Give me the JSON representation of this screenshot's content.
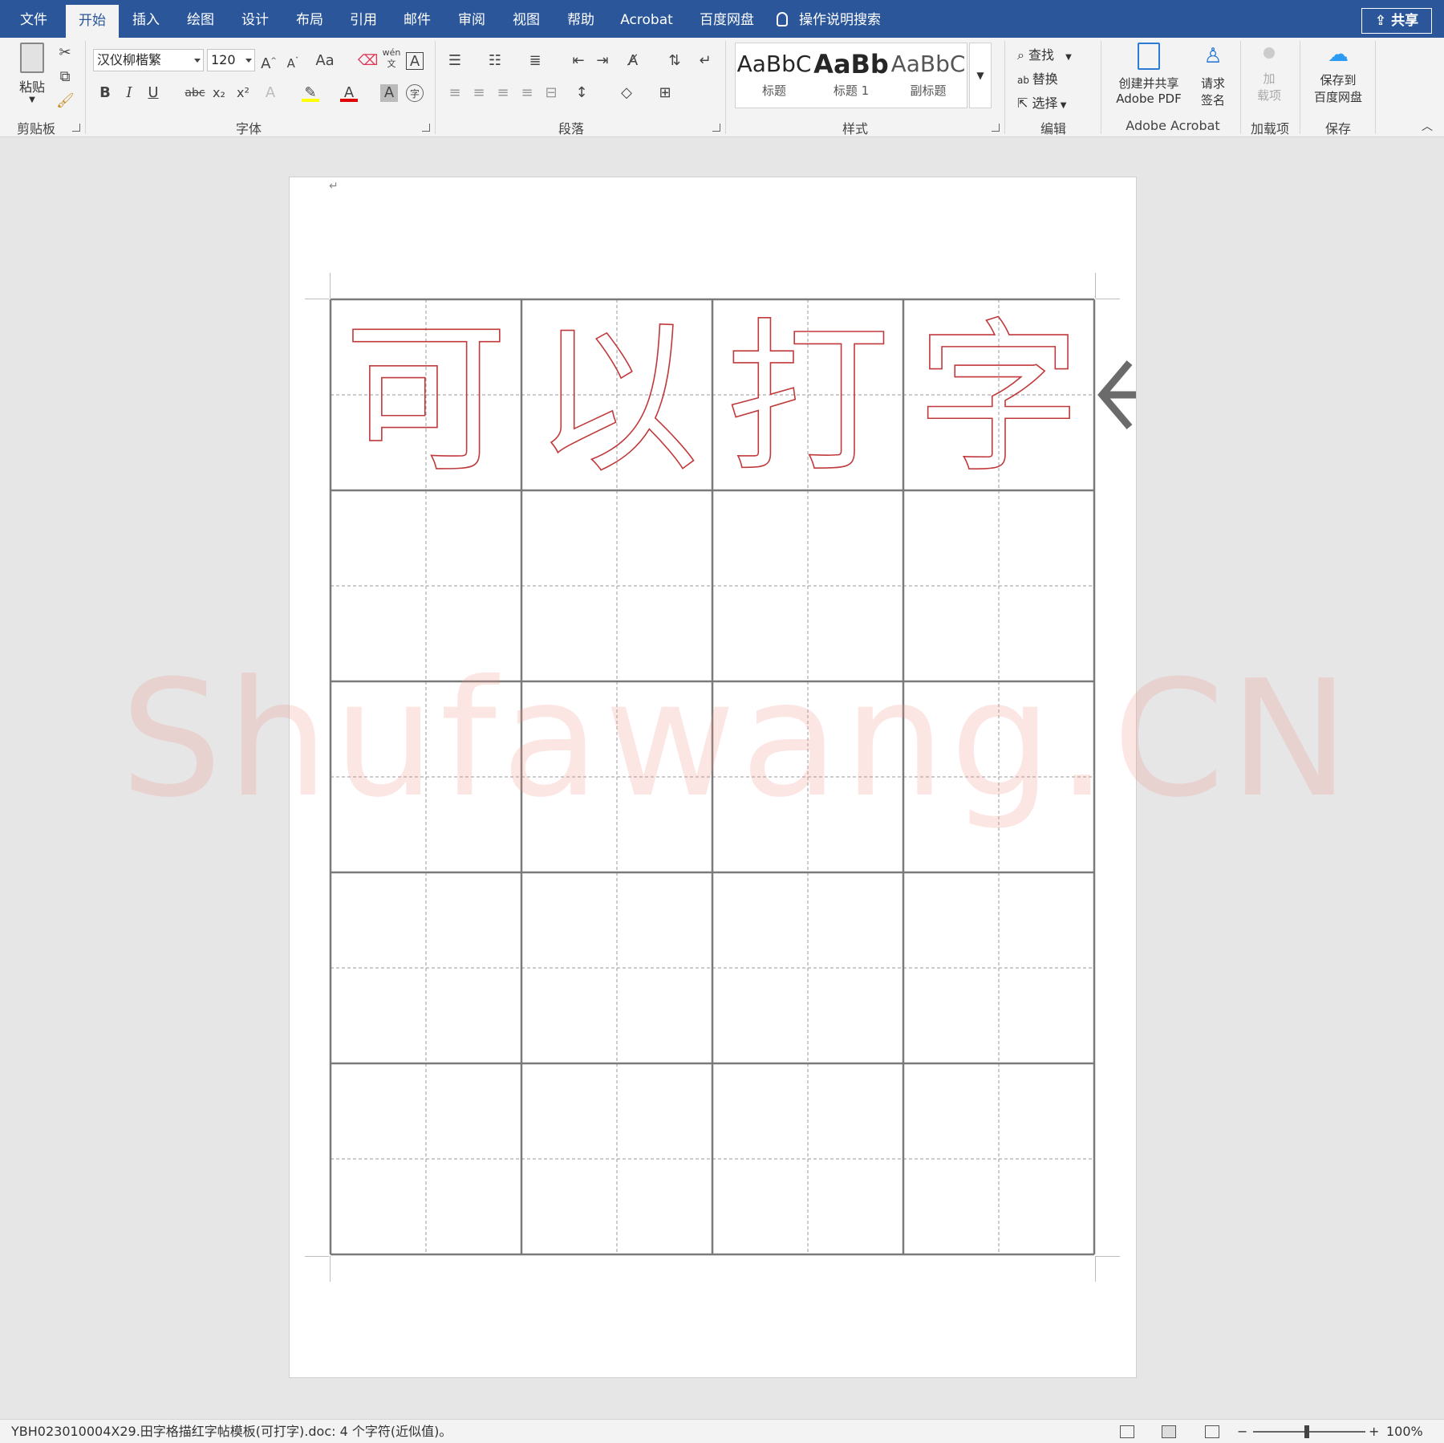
{
  "tabs": [
    {
      "label": "文件",
      "active": false
    },
    {
      "label": "开始",
      "active": true
    },
    {
      "label": "插入",
      "active": false
    },
    {
      "label": "绘图",
      "active": false
    },
    {
      "label": "设计",
      "active": false
    },
    {
      "label": "布局",
      "active": false
    },
    {
      "label": "引用",
      "active": false
    },
    {
      "label": "邮件",
      "active": false
    },
    {
      "label": "审阅",
      "active": false
    },
    {
      "label": "视图",
      "active": false
    },
    {
      "label": "帮助",
      "active": false
    },
    {
      "label": "Acrobat",
      "active": false
    },
    {
      "label": "百度网盘",
      "active": false
    }
  ],
  "tell_me": "操作说明搜索",
  "share": "共享",
  "clipboard": {
    "paste": "粘贴",
    "group": "剪贴板"
  },
  "font": {
    "name": "汉仪柳楷繁",
    "size": "120",
    "group": "字体",
    "case_label": "Aa",
    "bold": "B",
    "italic": "I",
    "underline": "U",
    "strike": "abc",
    "sub": "x₂",
    "sup": "x²",
    "phonetic": "wén 文",
    "char_border": "A"
  },
  "paragraph": {
    "group": "段落"
  },
  "styles": {
    "group": "样式",
    "items": [
      {
        "preview": "AaBbC",
        "name": "标题"
      },
      {
        "preview": "AaBb",
        "name": "标题 1"
      },
      {
        "preview": "AaBbC",
        "name": "副标题"
      }
    ]
  },
  "editing": {
    "find": "查找",
    "replace": "替换",
    "select": "选择",
    "group": "编辑"
  },
  "acrobat": {
    "create_share": "创建并共享",
    "create_share_2": "Adobe PDF",
    "request": "请求",
    "request_2": "签名",
    "group": "Adobe Acrobat"
  },
  "addins": {
    "label_1": "加",
    "label_2": "载项",
    "group": "加载项"
  },
  "save": {
    "label_1": "保存到",
    "label_2": "百度网盘",
    "group": "保存"
  },
  "document": {
    "characters": [
      "可",
      "以",
      "打",
      "字"
    ],
    "grid_rows": 5,
    "grid_cols": 4,
    "char_color": "#c0393b",
    "watermark": "Shufawang.CN"
  },
  "status": {
    "text": "YBH023010004X29.田字格描红字帖模板(可打字).doc: 4 个字符(近似值)。",
    "zoom": "100%"
  },
  "colors": {
    "accent": "#2b579a",
    "highlight": "#ffff00",
    "font_color": "#e00000"
  }
}
